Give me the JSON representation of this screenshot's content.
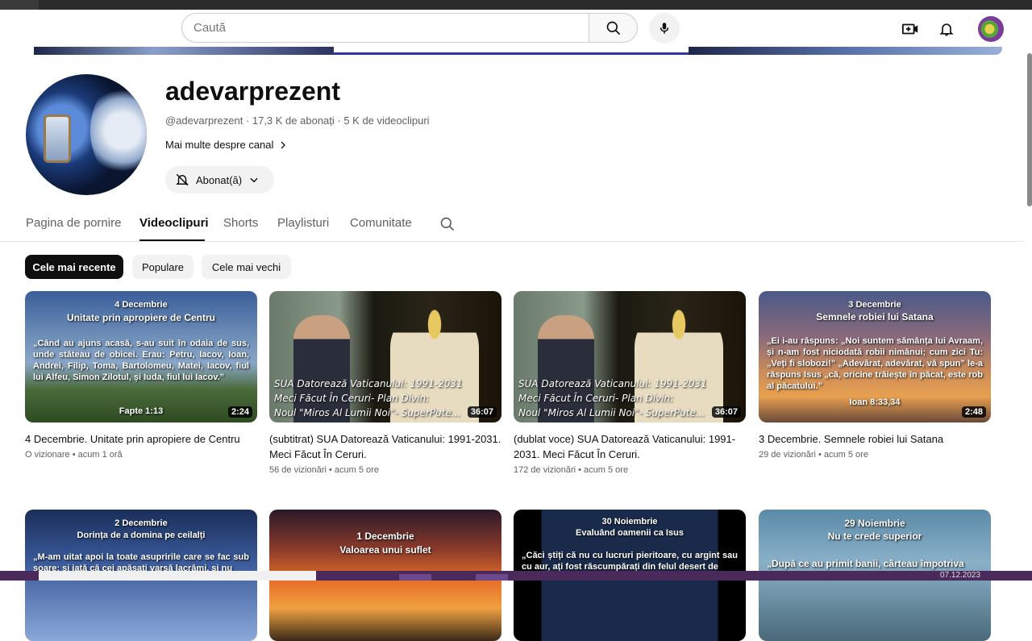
{
  "search": {
    "placeholder": "Caută"
  },
  "channel": {
    "name": "adevarprezent",
    "meta": "@adevarprezent · 17,3 K de abonați · 5 K de videoclipuri",
    "more_about": "Mai multe despre canal",
    "subscribe_label": "Abonat(ă)"
  },
  "tabs": [
    {
      "label": "Pagina de pornire"
    },
    {
      "label": "Videoclipuri"
    },
    {
      "label": "Shorts"
    },
    {
      "label": "Playlisturi"
    },
    {
      "label": "Comunitate"
    }
  ],
  "chips": [
    {
      "label": "Cele mai recente"
    },
    {
      "label": "Populare"
    },
    {
      "label": "Cele mai vechi"
    }
  ],
  "videos": [
    {
      "thumb_heading": "4 Decembrie",
      "thumb_subheading": "Unitate prin apropiere de Centru",
      "thumb_body": "„Când au ajuns acasă, s-au suit în odaia de sus, unde stăteau de obicei. Erau: Petru, Iacov, Ioan, Andrei, Filip, Toma, Bartolomeu, Matei, Iacov, fiul lui Alfeu, Simon Zilotul, și Iuda, fiul lui Iacov.”",
      "thumb_ref": "Fapte 1:13",
      "duration": "2:24",
      "title": "4 Decembrie. Unitate prin apropiere de Centru",
      "views": "O vizionare",
      "age": "acum 1 oră"
    },
    {
      "caption_lines": [
        "SUA Datorează Vaticanului: 1991-2031",
        "Meci Făcut În Ceruri- Plan Divin:",
        "Noul \"Miros Al Lumii Noi\"- SuperPute..."
      ],
      "duration": "36:07",
      "title": "(subtitrat) SUA Datorează Vaticanului: 1991-2031. Meci Făcut În Ceruri.",
      "views": "56 de vizionări",
      "age": "acum 5 ore"
    },
    {
      "caption_lines": [
        "SUA Datorează Vaticanului: 1991-2031",
        "Meci Făcut În Ceruri- Plan Divin:",
        "Noul \"Miros Al Lumii Noi\"- SuperPute..."
      ],
      "duration": "36:07",
      "title": "(dublat voce) SUA Datorează Vaticanului: 1991-2031. Meci Făcut În Ceruri.",
      "views": "172 de vizionări",
      "age": "acum 5 ore"
    },
    {
      "thumb_heading": "3 Decembrie",
      "thumb_subheading": "Semnele robiei lui Satana",
      "thumb_body": "„Ei i-au răspuns: „Noi suntem sămânța lui Avraam, și n-am fost niciodată robii nimănui; cum zici Tu: „Veți fi slobozi!” „Adevărat, adevărat, vă spun” le-a răspuns Isus „că, oricine trăiește în păcat, este rob al păcatului.”",
      "thumb_ref": "Ioan 8:33,34",
      "duration": "2:48",
      "title": "3 Decembrie. Semnele robiei lui Satana",
      "views": "29 de vizionări",
      "age": "acum 5 ore"
    },
    {
      "thumb_heading": "2 Decembrie",
      "thumb_subheading": "Dorința de a domina pe ceilalți",
      "thumb_body": "„M-am uitat apoi la toate asupririle care se fac sub soare; și iată că cei apăsați varsă lacrămi, și nu"
    },
    {
      "thumb_heading": "1 Decembrie",
      "thumb_subheading": "Valoarea unui suflet"
    },
    {
      "thumb_heading": "30 Noiembrie",
      "thumb_subheading": "Evaluând oamenii ca Isus",
      "thumb_body": "„Căci știți că nu cu lucruri pieritoare, cu argint sau cu aur, ați fost răscumpărați din felul desert de"
    },
    {
      "thumb_heading": "29 Noiembrie",
      "thumb_subheading": "Nu te crede superior",
      "thumb_body": "„După ce au primit banii, cârteau împotriva"
    }
  ],
  "taskbar": {
    "date": "07.12.2023"
  }
}
